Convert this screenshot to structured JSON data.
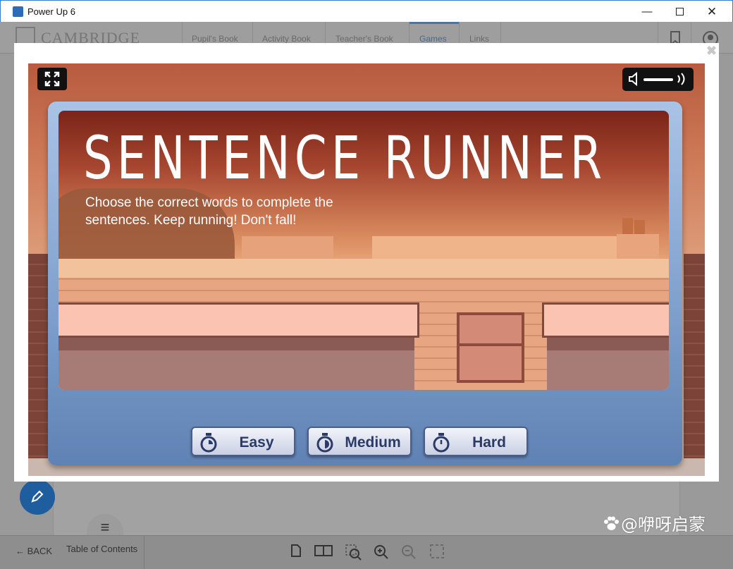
{
  "window": {
    "title": "Power Up 6",
    "minimize_glyph": "—",
    "close_glyph": "✕"
  },
  "app": {
    "logo_text": "CAMBRIDGE",
    "nav_tabs": [
      {
        "label": "Pupil's Book"
      },
      {
        "label": "Activity Book"
      },
      {
        "label": "Teacher's Book"
      },
      {
        "label": "Games",
        "active": true
      },
      {
        "label": "Links"
      }
    ],
    "bottom": {
      "back_label": "BACK",
      "toc_label": "Table of Contents"
    }
  },
  "modal": {
    "close_glyph": "✖"
  },
  "game": {
    "title": "SENTENCE RUNNER",
    "description": "Choose the correct words to complete the sentences. Keep running! Don't fall!",
    "buttons": {
      "easy": "Easy",
      "medium": "Medium",
      "hard": "Hard"
    },
    "volume_level": 0.75
  },
  "watermark": "@咿呀启蒙",
  "colors": {
    "accent_blue": "#3b78c2",
    "panel_blue": "#7d9ecb",
    "button_text": "#2b3a66"
  }
}
